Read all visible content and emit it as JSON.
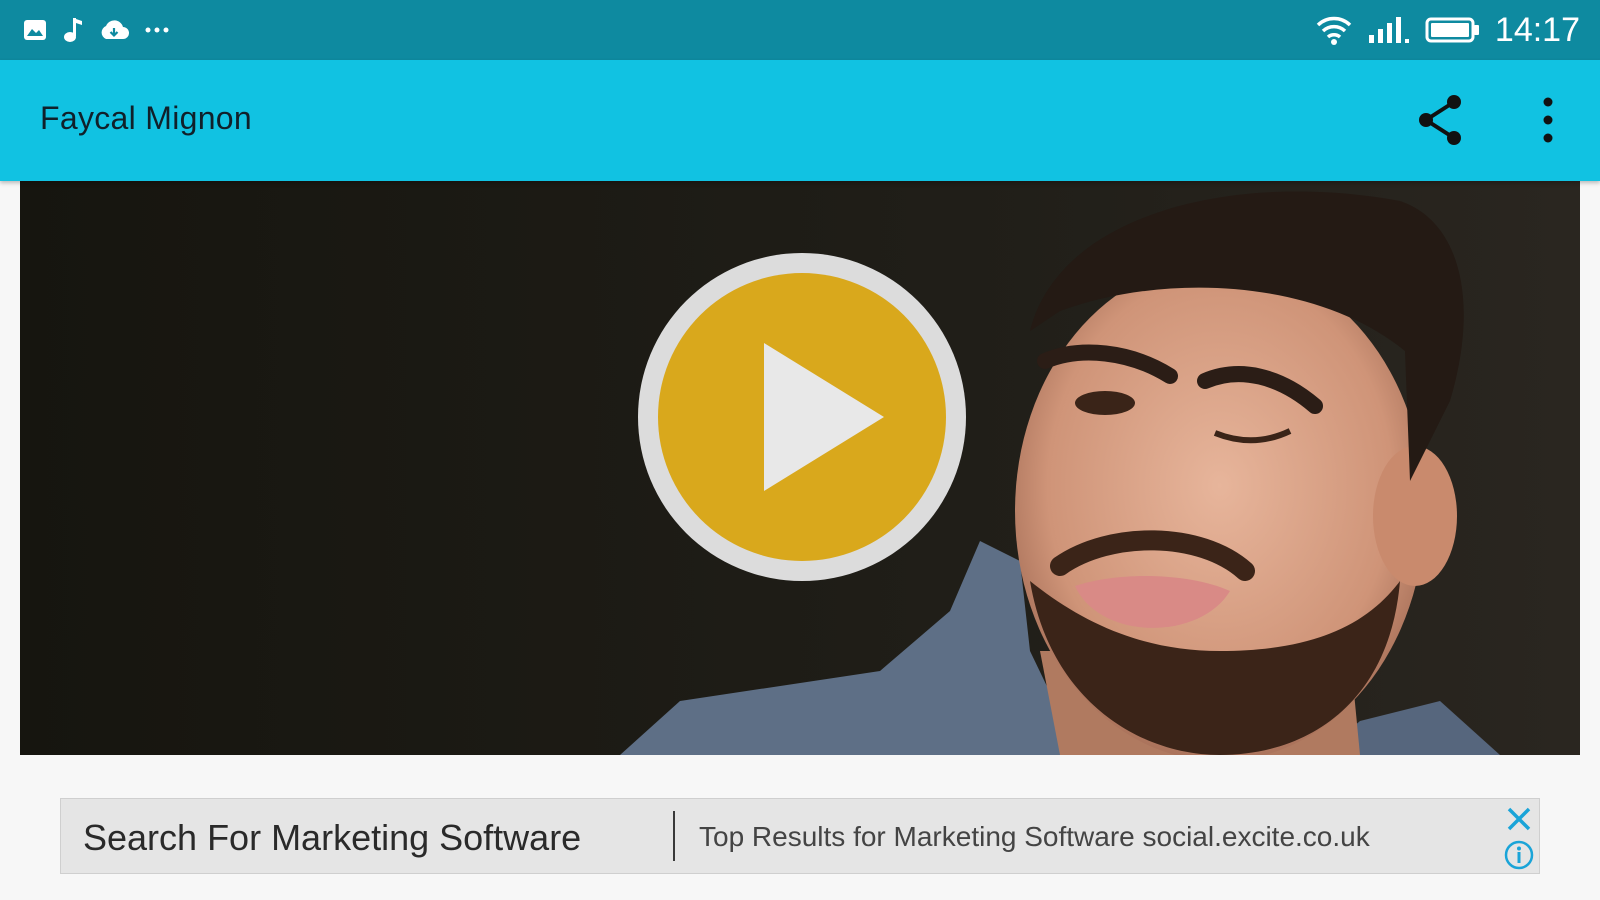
{
  "status_bar": {
    "time": "14:17",
    "left_icons": [
      "gallery-icon",
      "music-icon",
      "cloud-icon",
      "more-dots-icon"
    ],
    "right_icons": [
      "wifi-icon",
      "signal-icon",
      "battery-icon"
    ]
  },
  "app_bar": {
    "title": "Faycal Mignon",
    "actions": [
      "share-icon",
      "overflow-menu-icon"
    ],
    "color": "#11c2e2"
  },
  "player": {
    "play_icon": "play-icon",
    "accent_color": "#d9a81c"
  },
  "ad": {
    "headline": "Search For Marketing Software",
    "text": "Top Results for Marketing Software social.excite.co.uk",
    "close_icon": "close-icon",
    "info_icon": "info-icon"
  }
}
